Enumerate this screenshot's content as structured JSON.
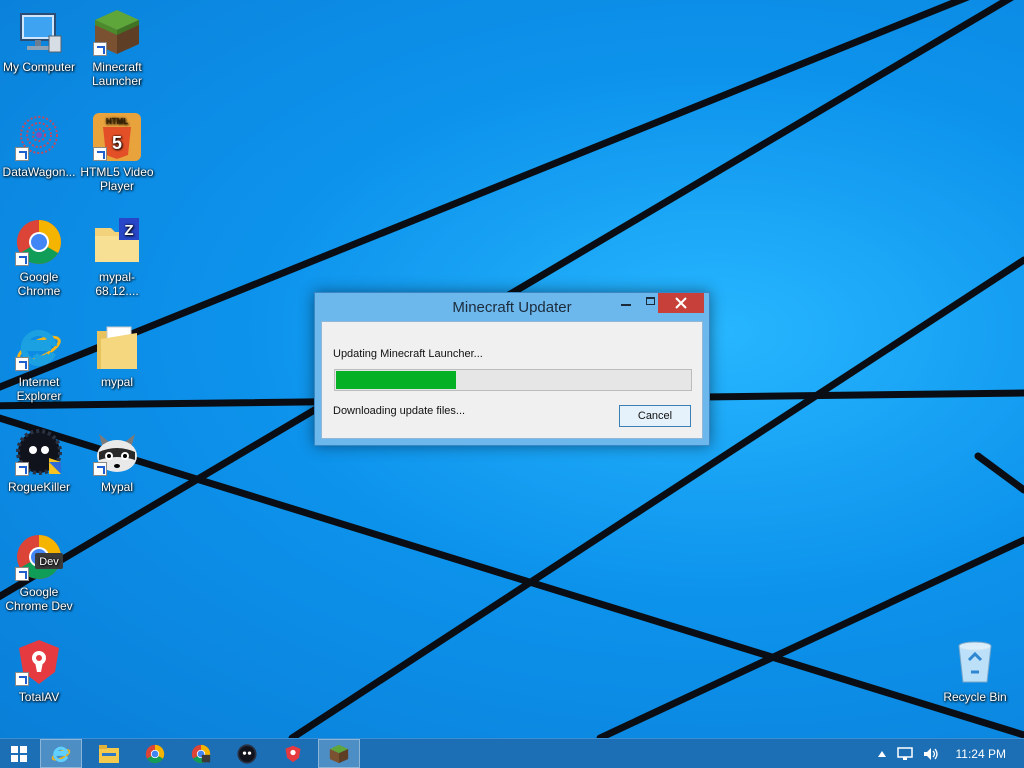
{
  "desktop": {
    "icons": [
      {
        "label": "My Computer",
        "icon": "computer-icon"
      },
      {
        "label": "Minecraft Launcher",
        "icon": "minecraft-icon"
      },
      {
        "label": "DataWagon...",
        "icon": "datawagon-icon"
      },
      {
        "label": "HTML5 Video Player",
        "icon": "html5-icon"
      },
      {
        "label": "Google Chrome",
        "icon": "chrome-icon"
      },
      {
        "label": "mypal-68.12....",
        "icon": "zip-folder-icon"
      },
      {
        "label": "Internet Explorer",
        "icon": "internet-explorer-icon"
      },
      {
        "label": "mypal",
        "icon": "folder-icon"
      },
      {
        "label": "RogueKiller",
        "icon": "roguekiller-icon"
      },
      {
        "label": "Mypal",
        "icon": "mypal-raccoon-icon"
      },
      {
        "label": "Google Chrome Dev",
        "icon": "chrome-dev-icon"
      },
      {
        "label": "TotalAV",
        "icon": "totalav-icon"
      },
      {
        "label": "Recycle Bin",
        "icon": "recycle-bin-icon"
      }
    ],
    "chrome_dev_badge": "Dev",
    "html5_badge": "HTML",
    "html5_number": "5",
    "zip_letter": "Z"
  },
  "dialog": {
    "title": "Minecraft Updater",
    "status_message": "Updating Minecraft Launcher...",
    "detail_message": "Downloading update files...",
    "progress": 0.34,
    "cancel_label": "Cancel"
  },
  "taskbar": {
    "apps": [
      "internet-explorer-icon",
      "file-explorer-icon",
      "chrome-icon",
      "chrome-dev-icon",
      "roguekiller-icon",
      "totalav-icon",
      "minecraft-icon"
    ],
    "clock": "11:24 PM"
  },
  "colors": {
    "wallpaper": "#0d93ec",
    "taskbar": "#1c6fb5",
    "close_button": "#c8403a",
    "progress_fill": "#06b025"
  }
}
